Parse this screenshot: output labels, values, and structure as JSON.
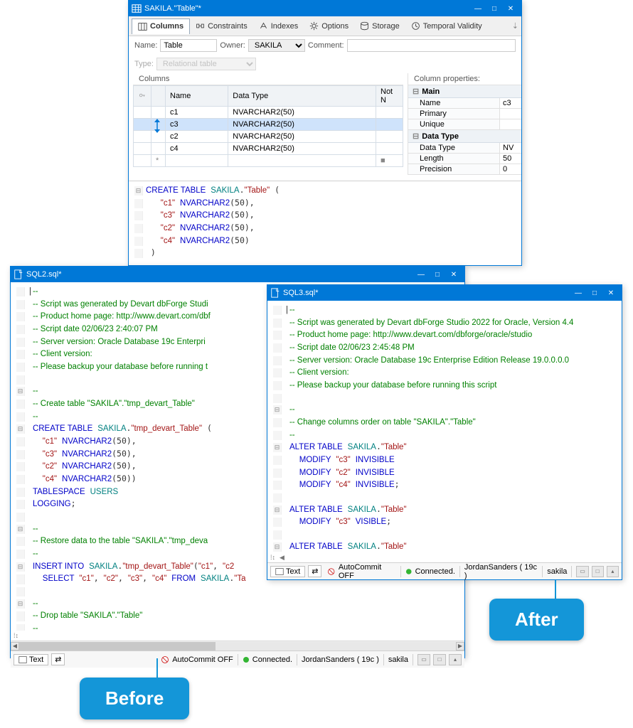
{
  "winMain": {
    "title": "SAKILA.\"Table\"*"
  },
  "tabs": {
    "columns": "Columns",
    "constraints": "Constraints",
    "indexes": "Indexes",
    "options": "Options",
    "storage": "Storage",
    "temporal": "Temporal Validity"
  },
  "form": {
    "nameLbl": "Name:",
    "nameVal": "Table",
    "ownerLbl": "Owner:",
    "ownerVal": "SAKILA",
    "commentLbl": "Comment:",
    "typeLbl": "Type:",
    "typeVal": "Relational table"
  },
  "colSection": "Columns",
  "gridHdr": {
    "name": "Name",
    "dtype": "Data Type",
    "notn": "Not N"
  },
  "gridRows": [
    {
      "name": "c1",
      "type": "NVARCHAR2(50)"
    },
    {
      "name": "c3",
      "type": "NVARCHAR2(50)",
      "sel": true
    },
    {
      "name": "c2",
      "type": "NVARCHAR2(50)"
    },
    {
      "name": "c4",
      "type": "NVARCHAR2(50)"
    }
  ],
  "propsTitle": "Column properties:",
  "props": {
    "mainHdr": "Main",
    "nameLbl": "Name",
    "nameVal": "c3",
    "primLbl": "Primary",
    "uniqLbl": "Unique",
    "dtHdr": "Data Type",
    "dtLbl": "Data Type",
    "dtVal": "NV",
    "lenLbl": "Length",
    "lenVal": "50",
    "precLbl": "Precision",
    "precVal": "0"
  },
  "winSql2": {
    "title": "SQL2.sql*"
  },
  "winSql3": {
    "title": "SQL3.sql*"
  },
  "sb": {
    "text": "Text",
    "autocommit": "AutoCommit OFF",
    "connected": "Connected.",
    "user": "JordanSanders ( 19c )",
    "db": "sakila"
  },
  "chips": {
    "before": "Before",
    "after": "After"
  }
}
